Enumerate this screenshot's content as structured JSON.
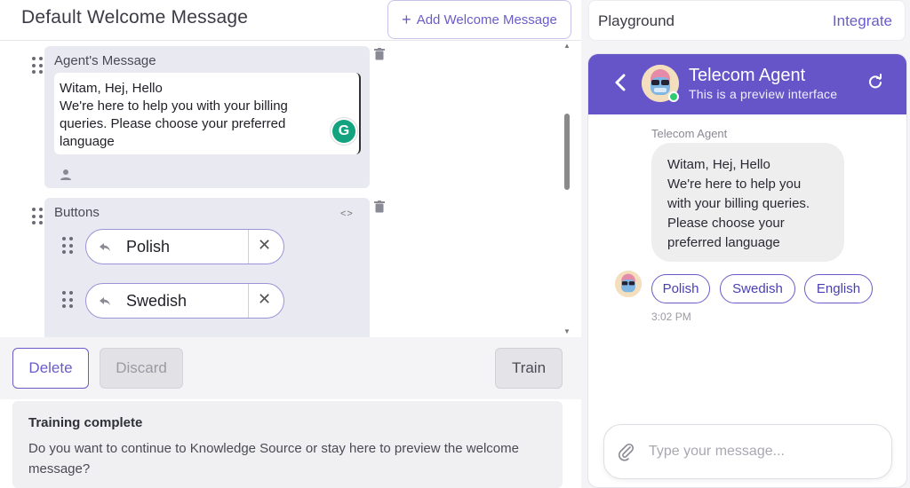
{
  "header": {
    "title": "Default Welcome Message",
    "add_button": "Add Welcome Message"
  },
  "agent_message_card": {
    "label": "Agent's Message",
    "text": "Witam, Hej, Hello\nWe're here to help you with your billing queries. Please choose your preferred language"
  },
  "buttons_card": {
    "label": "Buttons",
    "buttons": [
      {
        "label": "Polish"
      },
      {
        "label": "Swedish"
      }
    ]
  },
  "actions": {
    "delete": "Delete",
    "discard": "Discard",
    "train": "Train"
  },
  "notice": {
    "title": "Training complete",
    "body": "Do you want to continue to Knowledge Source or stay here to preview the welcome message?"
  },
  "playground": {
    "title": "Playground",
    "integrate": "Integrate"
  },
  "chat": {
    "agent_name": "Telecom Agent",
    "subtitle": "This is a preview interface",
    "sender_label": "Telecom Agent",
    "message": "Witam, Hej, Hello\nWe're here to help you\nwith your billing queries.\nPlease choose your\npreferred language",
    "quick_replies": [
      "Polish",
      "Swedish",
      "English"
    ],
    "time": "3:02 PM",
    "input_placeholder": "Type your message..."
  },
  "colors": {
    "accent": "#6555c8",
    "online": "#2ecc71"
  }
}
